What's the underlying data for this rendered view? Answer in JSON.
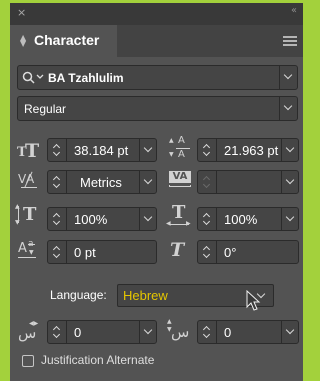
{
  "panel": {
    "close_glyph": "×",
    "collapse_glyph": "‹‹",
    "tab_title": "Character",
    "tab_icon": "diamond-expand-icon",
    "menu_icon": "hamburger-menu-icon"
  },
  "font_family": {
    "value": "BA Tzahlulim",
    "search_icon": "search-icon"
  },
  "font_style": {
    "value": "Regular"
  },
  "font_size": {
    "value": "38.184 pt"
  },
  "leading": {
    "value": "21.963 pt"
  },
  "kerning": {
    "value": "Metrics"
  },
  "tracking": {
    "value": ""
  },
  "vertical_scale": {
    "value": "100%"
  },
  "horizontal_scale": {
    "value": "100%"
  },
  "baseline_shift": {
    "value": "0 pt"
  },
  "skew": {
    "value": "0°"
  },
  "language": {
    "label": "Language:",
    "value": "Hebrew",
    "value_color": "#e4c600"
  },
  "diacritic_x": {
    "value": "0"
  },
  "diacritic_y": {
    "value": "0"
  },
  "justification": {
    "label": "Justification Alternate",
    "checked": false
  },
  "colors": {
    "background": "#a3d13c",
    "panel": "#535353",
    "field": "#454545"
  }
}
